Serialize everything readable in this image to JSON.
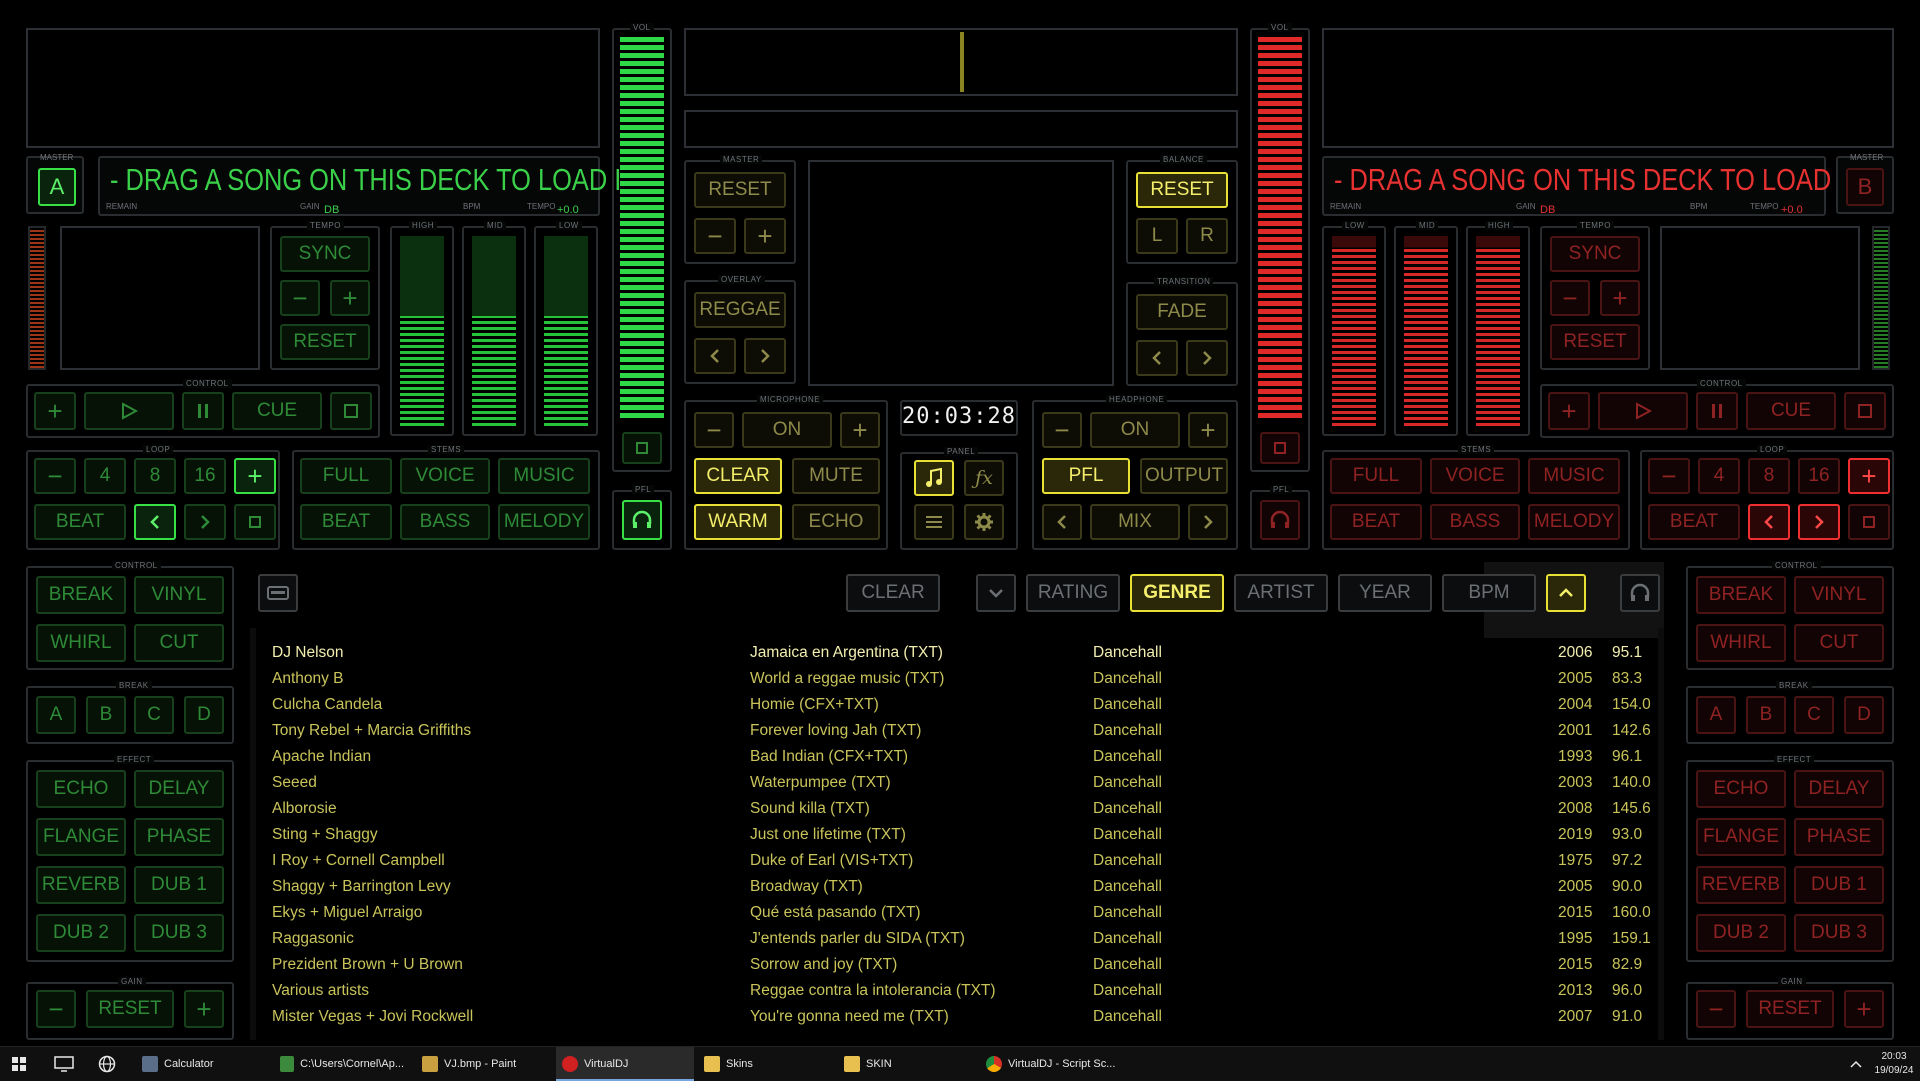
{
  "deck_a": {
    "master_label": "MASTER",
    "deck_letter": "A",
    "song_message": "- DRAG A SONG ON THIS DECK TO LOAD IT",
    "remain": "REMAIN",
    "gain": "GAIN",
    "db": "dB",
    "bpm": "BPM",
    "tempo": "TEMPO",
    "tempo_value": "+0.0",
    "tempo_label": "TEMPO",
    "sync": "SYNC",
    "reset": "RESET",
    "eq": [
      "HIGH",
      "MID",
      "LOW"
    ],
    "control_label": "CONTROL",
    "cue": "CUE",
    "loop_label": "LOOP",
    "loop_values": [
      "4",
      "8",
      "16"
    ],
    "beat": "BEAT",
    "stems_label": "STEMS",
    "stems": [
      "FULL",
      "VOICE",
      "MUSIC",
      "BEAT",
      "BASS",
      "MELODY"
    ],
    "color": "#3ad04a"
  },
  "deck_b": {
    "master_label": "MASTER",
    "deck_letter": "B",
    "song_message": "- DRAG A SONG ON THIS DECK TO LOAD IT",
    "remain": "REMAIN",
    "gain": "GAIN",
    "db": "dB",
    "bpm": "BPM",
    "tempo": "TEMPO",
    "tempo_value": "+0.0",
    "tempo_label": "TEMPO",
    "sync": "SYNC",
    "reset": "RESET",
    "eq": [
      "LOW",
      "MID",
      "HIGH"
    ],
    "control_label": "CONTROL",
    "cue": "CUE",
    "loop_label": "LOOP",
    "loop_values": [
      "4",
      "8",
      "16"
    ],
    "beat": "BEAT",
    "stems_label": "STEMS",
    "stems": [
      "FULL",
      "VOICE",
      "MUSIC",
      "BEAT",
      "BASS",
      "MELODY"
    ],
    "color": "#e83232"
  },
  "mixer": {
    "vol_label": "VOL",
    "pfl_label": "PFL",
    "master_label": "MASTER",
    "master_reset": "RESET",
    "balance_label": "BALANCE",
    "balance_reset": "RESET",
    "balance_l": "L",
    "balance_r": "R",
    "overlay_label": "OVERLAY",
    "overlay_value": "REGGAE",
    "transition_label": "TRANSITION",
    "transition_value": "FADE",
    "microphone_label": "MICROPHONE",
    "mic_on": "ON",
    "clear": "CLEAR",
    "mute": "MUTE",
    "warm": "WARM",
    "echo": "ECHO",
    "clock": "20:03:28",
    "panel_label": "PANEL",
    "headphone_label": "HEADPHONE",
    "hp_on": "ON",
    "pfl": "PFL",
    "output": "OUTPUT",
    "mix": "MIX"
  },
  "side_left": {
    "control_label": "CONTROL",
    "control": [
      "BREAK",
      "VINYL",
      "WHIRL",
      "CUT"
    ],
    "break_label": "BREAK",
    "break": [
      "A",
      "B",
      "C",
      "D"
    ],
    "effect_label": "EFFECT",
    "effects": [
      "ECHO",
      "DELAY",
      "FLANGE",
      "PHASE",
      "REVERB",
      "DUB 1",
      "DUB 2",
      "DUB 3"
    ],
    "gain_label": "GAIN",
    "gain_reset": "RESET"
  },
  "side_right": {
    "control_label": "CONTROL",
    "control": [
      "BREAK",
      "VINYL",
      "WHIRL",
      "CUT"
    ],
    "break_label": "BREAK",
    "break": [
      "A",
      "B",
      "C",
      "D"
    ],
    "effect_label": "EFFECT",
    "effects": [
      "ECHO",
      "DELAY",
      "FLANGE",
      "PHASE",
      "REVERB",
      "DUB 1",
      "DUB 2",
      "DUB 3"
    ],
    "gain_label": "GAIN",
    "gain_reset": "RESET"
  },
  "browser": {
    "clear": "CLEAR",
    "sort_buttons": [
      "RATING",
      "GENRE",
      "ARTIST",
      "YEAR",
      "BPM"
    ],
    "active_sort": "GENRE",
    "rows": [
      {
        "artist": "DJ Nelson",
        "title": "Jamaica en Argentina (TXT)",
        "genre": "Dancehall",
        "year": "2006",
        "bpm": "95.1"
      },
      {
        "artist": "Anthony B",
        "title": "World a reggae music (TXT)",
        "genre": "Dancehall",
        "year": "2005",
        "bpm": "83.3"
      },
      {
        "artist": "Culcha Candela",
        "title": "Homie (CFX+TXT)",
        "genre": "Dancehall",
        "year": "2004",
        "bpm": "154.0"
      },
      {
        "artist": "Tony Rebel + Marcia Griffiths",
        "title": "Forever loving Jah (TXT)",
        "genre": "Dancehall",
        "year": "2001",
        "bpm": "142.6"
      },
      {
        "artist": "Apache Indian",
        "title": "Bad Indian (CFX+TXT)",
        "genre": "Dancehall",
        "year": "1993",
        "bpm": "96.1"
      },
      {
        "artist": "Seeed",
        "title": "Waterpumpee (TXT)",
        "genre": "Dancehall",
        "year": "2003",
        "bpm": "140.0"
      },
      {
        "artist": "Alborosie",
        "title": "Sound killa (TXT)",
        "genre": "Dancehall",
        "year": "2008",
        "bpm": "145.6"
      },
      {
        "artist": "Sting + Shaggy",
        "title": "Just one lifetime (TXT)",
        "genre": "Dancehall",
        "year": "2019",
        "bpm": "93.0"
      },
      {
        "artist": "I Roy + Cornell Campbell",
        "title": "Duke of Earl (VIS+TXT)",
        "genre": "Dancehall",
        "year": "1975",
        "bpm": "97.2"
      },
      {
        "artist": "Shaggy + Barrington Levy",
        "title": "Broadway (TXT)",
        "genre": "Dancehall",
        "year": "2005",
        "bpm": "90.0"
      },
      {
        "artist": "Ekys + Miguel Arraigo",
        "title": "Qué está pasando (TXT)",
        "genre": "Dancehall",
        "year": "2015",
        "bpm": "160.0"
      },
      {
        "artist": "Raggasonic",
        "title": "J'entends parler du SIDA (TXT)",
        "genre": "Dancehall",
        "year": "1995",
        "bpm": "159.1"
      },
      {
        "artist": "Prezident Brown + U Brown",
        "title": "Sorrow and joy (TXT)",
        "genre": "Dancehall",
        "year": "2015",
        "bpm": "82.9"
      },
      {
        "artist": "Various artists",
        "title": "Reggae contra la intolerancia (TXT)",
        "genre": "Dancehall",
        "year": "2013",
        "bpm": "96.0"
      },
      {
        "artist": "Mister Vegas + Jovi Rockwell",
        "title": "You're gonna need me (TXT)",
        "genre": "Dancehall",
        "year": "2007",
        "bpm": "91.0"
      }
    ]
  },
  "taskbar": {
    "items": [
      "Calculator",
      "C:\\Users\\Cornel\\Ap...",
      "VJ.bmp - Paint",
      "VirtualDJ",
      "Skins",
      "SKIN",
      "VirtualDJ - Script Sc..."
    ],
    "time": "20:03",
    "date": "19/09/24"
  }
}
